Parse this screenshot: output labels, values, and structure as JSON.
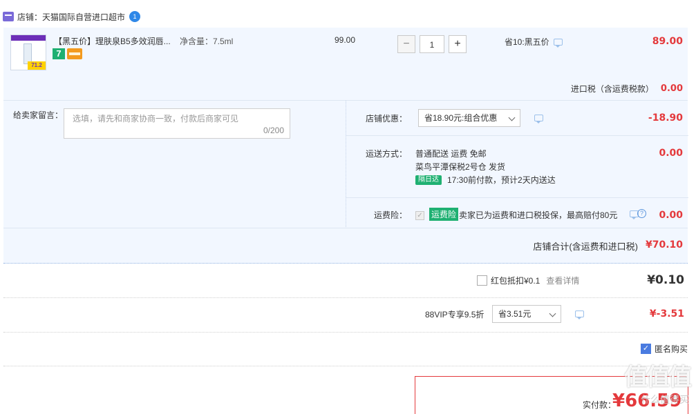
{
  "shop": {
    "label": "店铺：天猫国际自营进口超市",
    "badge": "1"
  },
  "item": {
    "thumb_price": "71.2",
    "title": "【黑五价】理肤泉B5多效润唇...",
    "spec": "净含量：7.5ml",
    "badge_seven": "7",
    "unit_price": "99.00",
    "qty_minus": "−",
    "qty_value": "1",
    "qty_plus": "+",
    "promo": "省10:黑五价",
    "total": "89.00"
  },
  "tax": {
    "label": "进口税（含运费税款）",
    "value": "0.00"
  },
  "message": {
    "label": "给卖家留言：",
    "placeholder": "选填，请先和商家协商一致，付款后商家可见",
    "count": "0/200"
  },
  "discount": {
    "label": "店铺优惠：",
    "selected": "省18.90元:组合优惠",
    "value": "-18.90"
  },
  "shipping": {
    "label": "运送方式：",
    "line1": "普通配送 运费 免邮",
    "line2": "菜鸟平潭保税2号仓  发货",
    "tag": "隔日达",
    "line3": "17:30前付款，预计2天内送达",
    "value": "0.00"
  },
  "insurance": {
    "label": "运费险：",
    "tag": "运费险",
    "text": "卖家已为运费和进口税投保，最高赔付80元",
    "value": "0.00"
  },
  "shop_total": {
    "label": "店铺合计(含运费和进口税)",
    "value": "¥70.10"
  },
  "red_packet": {
    "label": "红包抵扣¥0.1",
    "link": "查看详情",
    "value": "¥0.10"
  },
  "vip": {
    "label": "88VIP专享9.5折",
    "selected": "省3.51元",
    "value": "¥-3.51"
  },
  "anonymous": {
    "label": "匿名购买"
  },
  "payment": {
    "label": "实付款：",
    "value": "¥66.59"
  },
  "watermark": {
    "text": "值值值",
    "sub": "什么值得买"
  },
  "colors": {
    "accent_red": "#e4393c",
    "panel_bg": "#f2f7ff",
    "green_tag": "#1fb072",
    "check_blue": "#4a7be0"
  }
}
